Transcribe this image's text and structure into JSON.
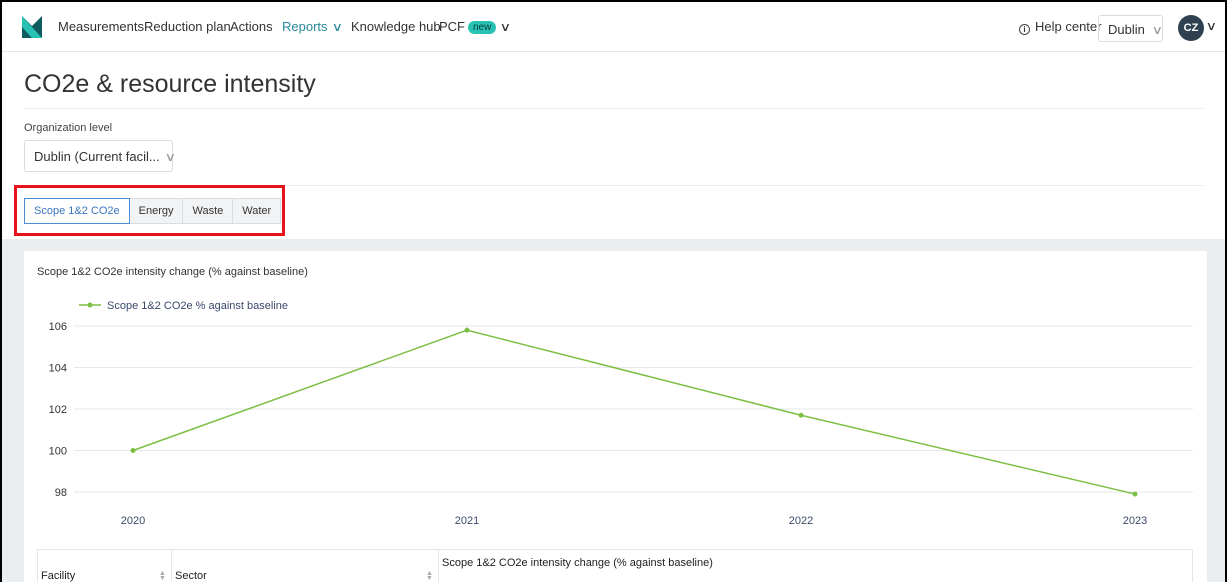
{
  "nav": {
    "items": [
      {
        "label": "Measurements",
        "x": 56
      },
      {
        "label": "Reduction plan",
        "x": 142
      },
      {
        "label": "Actions",
        "x": 228
      },
      {
        "label": "Reports",
        "x": 280,
        "active": true,
        "dropdown": true
      },
      {
        "label": "Knowledge hub",
        "x": 349
      },
      {
        "label": "PCF",
        "x": 437,
        "badge": "new",
        "dropdown": true
      }
    ],
    "help": "Help center",
    "location": "Dublin",
    "avatar": "CZ",
    "accent": "#2a8a9c",
    "logo_colors": [
      "#0f5a5f",
      "#28c2b4"
    ]
  },
  "page": {
    "title": "CO2e & resource intensity",
    "org_label": "Organization level",
    "org_value": "Dublin (Current facil..."
  },
  "tabs": [
    {
      "label": "Scope 1&2 CO2e",
      "active": true
    },
    {
      "label": "Energy"
    },
    {
      "label": "Waste"
    },
    {
      "label": "Water"
    }
  ],
  "chart": {
    "heading": "Scope 1&2 CO2e intensity change (% against baseline)"
  },
  "chart_data": {
    "type": "line",
    "x": [
      "2020",
      "2021",
      "2022",
      "2023"
    ],
    "series": [
      {
        "name": "Scope 1&2 CO2e % against baseline",
        "values": [
          100,
          105.8,
          101.7,
          97.9
        ],
        "color": "#7dbf44"
      }
    ],
    "yticks": [
      98,
      100,
      102,
      104,
      106
    ],
    "ylim": [
      97.5,
      106.5
    ],
    "grid": true,
    "legend": "top-left"
  },
  "table": {
    "columns": [
      "Facility",
      "Sector",
      "Scope 1&2 CO2e intensity change (% against baseline)"
    ]
  }
}
